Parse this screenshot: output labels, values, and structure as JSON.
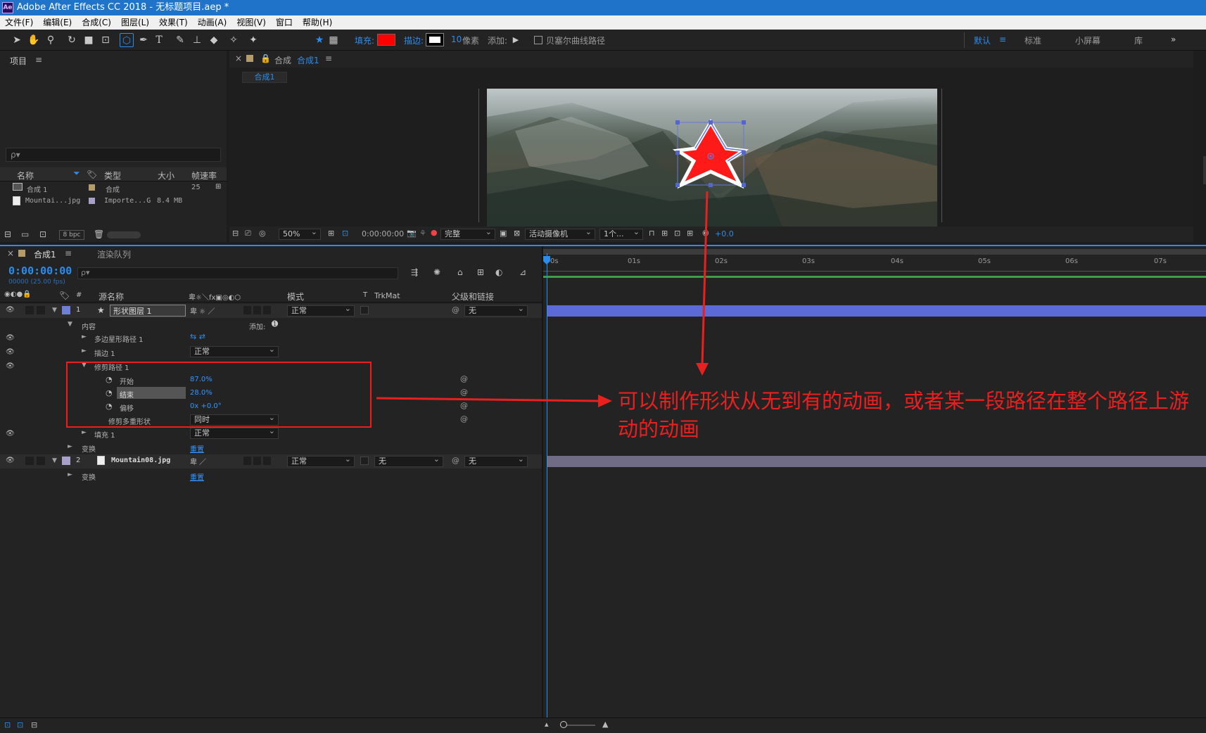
{
  "window": {
    "title": "Adobe After Effects CC 2018 - 无标题项目.aep *",
    "app_icon": "Ae"
  },
  "menu": [
    "文件(F)",
    "编辑(E)",
    "合成(C)",
    "图层(L)",
    "效果(T)",
    "动画(A)",
    "视图(V)",
    "窗口",
    "帮助(H)"
  ],
  "toolbar": {
    "fill_label": "填充:",
    "stroke_label": "描边:",
    "stroke_width": "10",
    "stroke_unit": "像素",
    "add_label": "添加:",
    "bezier_label": "贝塞尔曲线路径",
    "workspaces": [
      "默认",
      "标准",
      "小屏幕",
      "库"
    ],
    "more": "»",
    "fill_color": "#ff0000",
    "accent": "#2d8ceb"
  },
  "project": {
    "title": "项目",
    "search_placeholder": "ρ▾",
    "columns": [
      "名称",
      "类型",
      "大小",
      "帧速率"
    ],
    "items": [
      {
        "name": "合成 1",
        "type": "合成",
        "size": "",
        "fps": "25",
        "swatch": "#b59a6a"
      },
      {
        "name": "Mountai...jpg",
        "type": "Importe...G",
        "size": "8.4 MB",
        "fps": "",
        "swatch": "#a8a0c8"
      }
    ],
    "bpc": "8 bpc"
  },
  "comp_viewer": {
    "tab_prefix": "合成",
    "tab_name": "合成1",
    "breadcrumb": "合成1",
    "zoom": "50%",
    "timecode": "0:00:00:00",
    "quality": "完整",
    "camera": "活动摄像机",
    "views": "1个...",
    "exposure": "+0.0"
  },
  "timeline": {
    "tab": "合成1",
    "render_queue": "渲染队列",
    "timecode": "0:00:00:00",
    "frames": "00000 (25.00 fps)",
    "columns": {
      "num": "#",
      "source": "源名称",
      "mode": "模式",
      "t": "T",
      "trkmat": "TrkMat",
      "parent": "父级和链接"
    },
    "ruler": [
      "0s",
      "01s",
      "02s",
      "03s",
      "04s",
      "05s",
      "06s",
      "07s"
    ],
    "layers": [
      {
        "num": "1",
        "name": "形状图层 1",
        "mode": "正常",
        "parent": "无",
        "color": "#6f7fd6"
      },
      {
        "num": "2",
        "name": "Mountain08.jpg",
        "mode": "正常",
        "trkmat": "无",
        "parent": "无",
        "color": "#a8a0c8"
      }
    ],
    "props": {
      "contents": "内容",
      "add": "添加:",
      "polystar": "多边星形路径 1",
      "stroke": "描边 1",
      "stroke_mode": "正常",
      "trim": "修剪路径 1",
      "start_label": "开始",
      "start_val": "87.0%",
      "end_label": "结束",
      "end_val": "28.0%",
      "offset_label": "偏移",
      "offset_val": "0x +0.0°",
      "trim_multiple": "修剪多重形状",
      "trim_mode": "同时",
      "fill": "填充 1",
      "fill_mode": "正常",
      "transform": "变换",
      "reset": "重置"
    }
  },
  "annotation": {
    "text": "可以制作形状从无到有的动画，或者某一段路径在整个路径上游动的动画",
    "color": "#e8201f"
  }
}
